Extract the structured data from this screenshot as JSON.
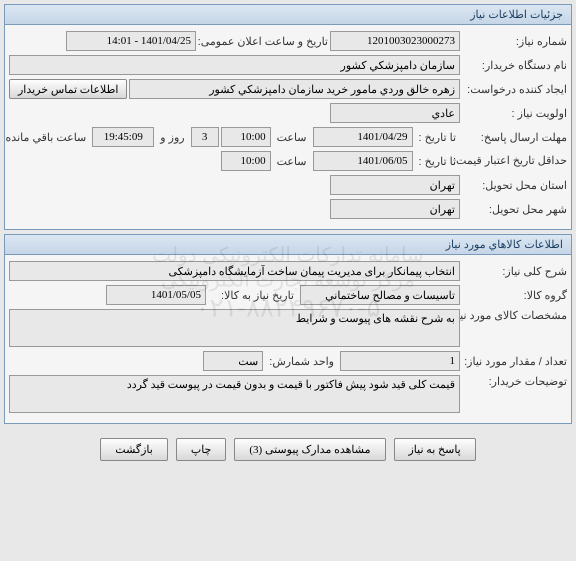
{
  "section1": {
    "title": "جزئیات اطلاعات نیاز",
    "request_number_label": "شماره نیاز:",
    "request_number": "1201003023000273",
    "public_announce_label": "تاریخ و ساعت اعلان عمومی:",
    "public_announce_datetime": "1401/04/25 - 14:01",
    "buyer_org_label": "نام دستگاه خریدار:",
    "buyer_org": "سازمان دامپزشكي كشور",
    "creator_label": "ایجاد کننده درخواست:",
    "creator": "زهره خالق وردي مامور خريد سازمان دامپزشكي كشور",
    "contact_btn": "اطلاعات تماس خریدار",
    "priority_label": "اولویت نیاز :",
    "priority": "عادي",
    "response_deadline_label": "مهلت ارسال پاسخ:",
    "until_label": "تا تاریخ :",
    "response_date": "1401/04/29",
    "time_label": "ساعت",
    "response_time": "10:00",
    "days_remain": "3",
    "days_remain_label": "روز و",
    "time_remain": "19:45:09",
    "time_remain_label": "ساعت باقي مانده",
    "price_valid_label": "حداقل تاریخ اعتبار قیمت:",
    "price_valid_date": "1401/06/05",
    "price_valid_time": "10:00",
    "delivery_state_label": "استان محل تحویل:",
    "delivery_state": "تهران",
    "delivery_city_label": "شهر محل تحویل:",
    "delivery_city": "تهران"
  },
  "section2": {
    "title": "اطلاعات كالاهاي مورد نیاز",
    "desc_label": "شرح کلی نیاز:",
    "desc": "انتخاب پیمانكار برای مديريت پيمان ساخت آزمايشگاه دامپزشكی",
    "group_label": "گروه کالا:",
    "group": "تاسيسات و مصالح ساختماني",
    "need_date_label": "تاریخ نیاز به کالا:",
    "need_date": "1401/05/05",
    "spec_label": "مشخصات کالای مورد نیاز:",
    "spec": "به شرح نقشه های پیوست و شرایط",
    "qty_label": "تعداد / مقدار مورد نیاز:",
    "qty": "1",
    "unit_label": "واحد شمارش:",
    "unit": "ست",
    "buyer_notes_label": "توضیحات خریدار:",
    "buyer_notes": "قیمت کلی قید شود پیش فاکتور با قیمت و بدون قیمت در پیوست قید گردد"
  },
  "actions": {
    "respond": "پاسخ به نیاز",
    "attachments": "مشاهده مدارک پیوستی (3)",
    "print": "چاپ",
    "back": "بازگشت"
  },
  "watermark": {
    "line1": "سامانه تدارکات الکترونیکی دولت",
    "line2": "مرکز توسعه تجارت الکترونیکی",
    "line3": "۰۲۱-۸۸۲۴۹۶۷۰-۵"
  }
}
